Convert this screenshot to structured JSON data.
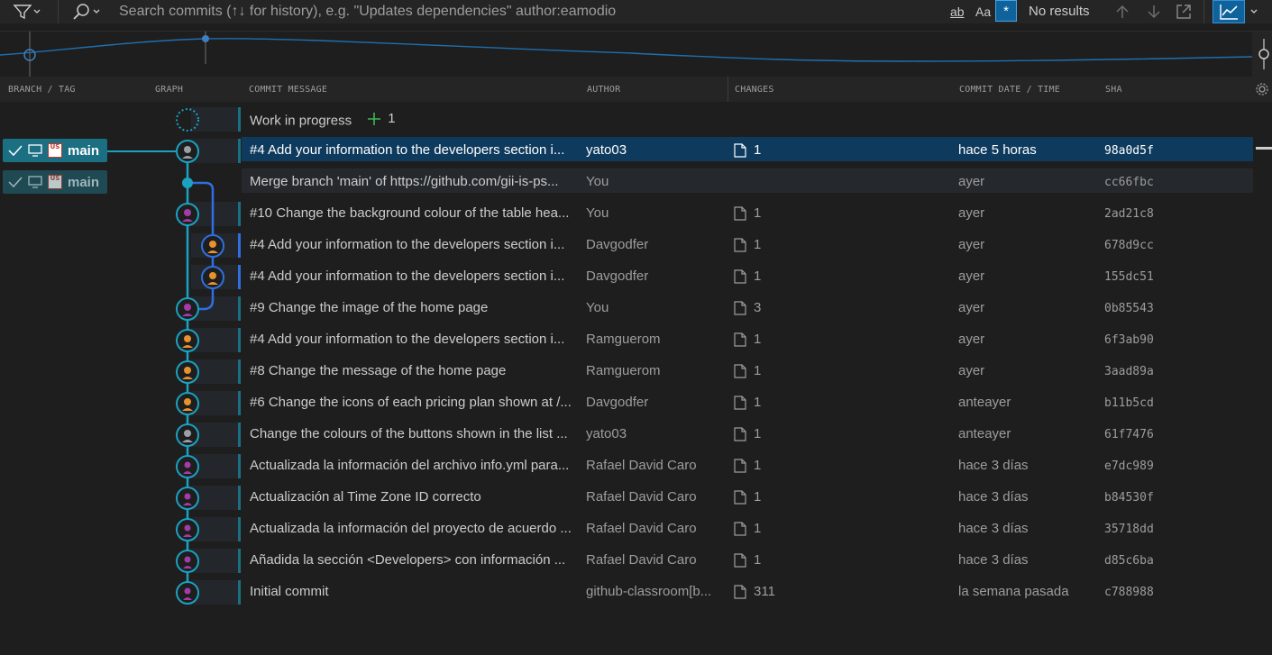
{
  "toolbar": {
    "search_placeholder": "Search commits (↑↓ for history), e.g. \"Updates dependencies\" author:eamodio",
    "match_whole_word": "ab",
    "match_case": "Aa",
    "regex": "*",
    "results_text": "No results"
  },
  "columns": {
    "branch_tag": "BRANCH / TAG",
    "graph": "GRAPH",
    "message": "COMMIT MESSAGE",
    "author": "AUTHOR",
    "changes": "CHANGES",
    "date": "COMMIT DATE / TIME",
    "sha": "SHA"
  },
  "branches": [
    {
      "label": "main",
      "flag_text": "US"
    },
    {
      "label": "main",
      "flag_text": "US"
    }
  ],
  "wip": {
    "label": "Work in progress",
    "count": "1"
  },
  "commits": [
    {
      "message": "#4 Add your information to the developers section i...",
      "author": "yato03",
      "changes": "1",
      "date": "hace 5 horas",
      "sha": "98a0d5f"
    },
    {
      "message": "Merge branch 'main' of https://github.com/gii-is-ps...",
      "author": "You",
      "changes": "",
      "date": "ayer",
      "sha": "cc66fbc"
    },
    {
      "message": "#10 Change the background colour of the table hea...",
      "author": "You",
      "changes": "1",
      "date": "ayer",
      "sha": "2ad21c8"
    },
    {
      "message": "#4 Add your information to the developers section i...",
      "author": "Davgodfer",
      "changes": "1",
      "date": "ayer",
      "sha": "678d9cc"
    },
    {
      "message": "#4 Add your information to the developers section i...",
      "author": "Davgodfer",
      "changes": "1",
      "date": "ayer",
      "sha": "155dc51"
    },
    {
      "message": "#9 Change the image of the home page",
      "author": "You",
      "changes": "3",
      "date": "ayer",
      "sha": "0b85543"
    },
    {
      "message": "#4 Add your information to the developers section i...",
      "author": "Ramguerom",
      "changes": "1",
      "date": "ayer",
      "sha": "6f3ab90"
    },
    {
      "message": "#8 Change the message of the home page",
      "author": "Ramguerom",
      "changes": "1",
      "date": "ayer",
      "sha": "3aad89a"
    },
    {
      "message": "#6 Change the icons of each pricing plan shown at /...",
      "author": "Davgodfer",
      "changes": "1",
      "date": "anteayer",
      "sha": "b11b5cd"
    },
    {
      "message": "Change the colours of the buttons shown in the list ...",
      "author": "yato03",
      "changes": "1",
      "date": "anteayer",
      "sha": "61f7476"
    },
    {
      "message": "Actualizada la información del archivo info.yml para...",
      "author": "Rafael David Caro",
      "changes": "1",
      "date": "hace 3 días",
      "sha": "e7dc989"
    },
    {
      "message": "Actualización al Time Zone ID correcto",
      "author": "Rafael David Caro",
      "changes": "1",
      "date": "hace 3 días",
      "sha": "b84530f"
    },
    {
      "message": "Actualizada la información del proyecto de acuerdo ...",
      "author": "Rafael David Caro",
      "changes": "1",
      "date": "hace 3 días",
      "sha": "35718dd"
    },
    {
      "message": "Añadida la sección <Developers> con información ...",
      "author": "Rafael David Caro",
      "changes": "1",
      "date": "hace 3 días",
      "sha": "d85c6ba"
    },
    {
      "message": "Initial commit",
      "author": "github-classroom[b...",
      "changes": "311",
      "date": "la semana pasada",
      "sha": "c788988"
    }
  ],
  "colors": {
    "lane_main": "#1ba1c2",
    "lane_branch": "#2f6fe0",
    "selected_row": "#0e3a5e",
    "branch_pill": "#1b6f82",
    "accent": "#0e639c"
  }
}
